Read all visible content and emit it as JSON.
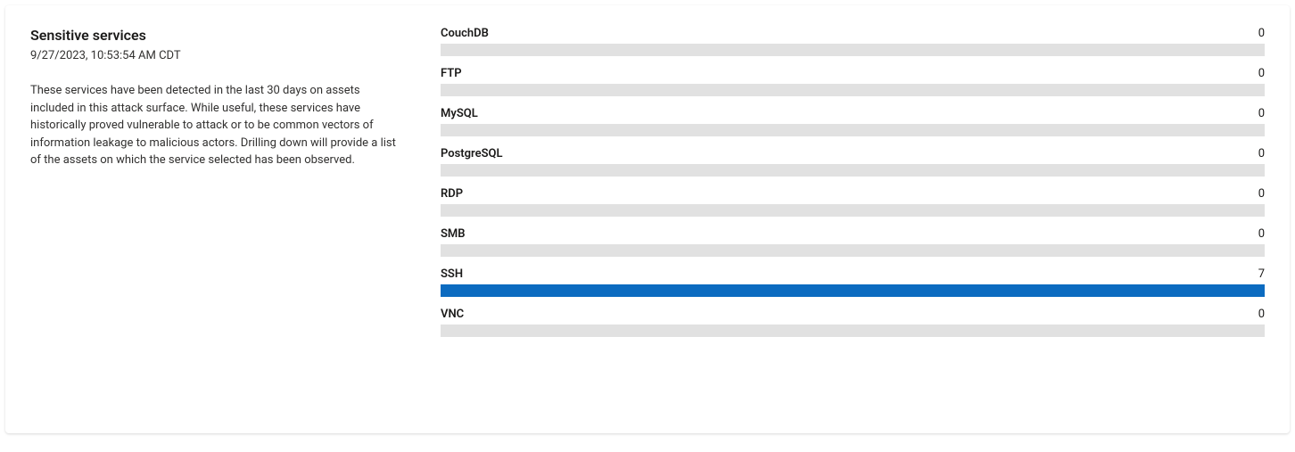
{
  "panel": {
    "title": "Sensitive services",
    "timestamp": "9/27/2023, 10:53:54 AM CDT",
    "description": "These services have been detected in the last 30 days on assets included in this attack surface. While useful, these services have historically proved vulnerable to attack or to be common vectors of information leakage to malicious actors. Drilling down will provide a list of the assets on which the service selected has been observed."
  },
  "colors": {
    "bar_fill": "#0c6bc0",
    "bar_track": "#e1e1e1"
  },
  "chart_data": {
    "type": "bar",
    "orientation": "horizontal",
    "title": "Sensitive services",
    "xlabel": "",
    "ylabel": "",
    "categories": [
      "CouchDB",
      "FTP",
      "MySQL",
      "PostgreSQL",
      "RDP",
      "SMB",
      "SSH",
      "VNC"
    ],
    "values": [
      0,
      0,
      0,
      0,
      0,
      0,
      7,
      0
    ],
    "max": 7
  }
}
